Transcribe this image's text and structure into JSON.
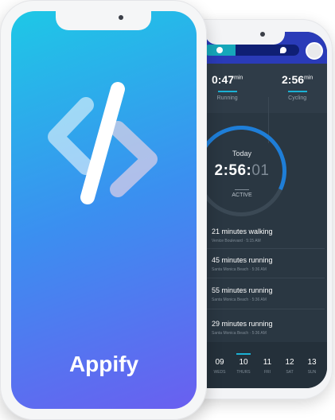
{
  "front": {
    "brand": "Appify"
  },
  "back": {
    "stats": [
      {
        "value": "0:47",
        "unit": "min",
        "label": "Running"
      },
      {
        "value": "2:56",
        "unit": "min",
        "label": "Cycling"
      }
    ],
    "today_label": "Today",
    "time_main": "2:56:",
    "time_dim": "01",
    "active_label": "ACTIVE",
    "activities": [
      {
        "title": "21 minutes walking",
        "subtitle": "Venice Boulevard · 5:15 AM"
      },
      {
        "title": "45 minutes running",
        "subtitle": "Santa Monica Beach · 5:36 AM"
      },
      {
        "title": "55 minutes running",
        "subtitle": "Santa Monica Beach · 5:36 AM"
      },
      {
        "title": "29 minutes running",
        "subtitle": "Santa Monica Beach · 5:36 AM"
      }
    ],
    "days": [
      {
        "num": "09",
        "label": "WEDS"
      },
      {
        "num": "10",
        "label": "THURS"
      },
      {
        "num": "11",
        "label": "FRI"
      },
      {
        "num": "12",
        "label": "SAT"
      },
      {
        "num": "13",
        "label": "SUN"
      }
    ],
    "accent": "#1bb1d4"
  }
}
